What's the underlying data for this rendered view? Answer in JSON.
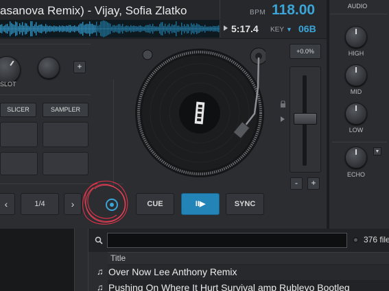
{
  "header": {
    "track_title": "asanova Remix) - Vijay, Sofia Zlatko",
    "bpm_label": "BPM",
    "bpm_value": "118.00",
    "time": "5:17.4",
    "key_label": "KEY",
    "key_caret": "▼",
    "key_value": "06B"
  },
  "audio_panel": {
    "title": "AUDIO",
    "high_label": "HIGH",
    "mid_label": "MID",
    "low_label": "LOW",
    "echo_label": "ECHO",
    "echo_dropdown": "▼"
  },
  "left_section": {
    "slot_label": "SLOT",
    "plus": "+",
    "slicer": "SLICER",
    "sampler": "SAMPLER"
  },
  "transport": {
    "prev": "‹",
    "loop_size": "1/4",
    "next": "›",
    "cue": "CUE",
    "play": "II▶",
    "sync": "SYNC"
  },
  "pitch": {
    "readout": "+0.0%",
    "minus": "-",
    "plus": "+"
  },
  "browser": {
    "search_value": "",
    "file_count": "376 file",
    "column_title": "Title",
    "rows": [
      {
        "icon": "♫",
        "title": "Over Now Lee Anthony Remix"
      },
      {
        "icon": "♫",
        "title": "Pushing On Where It Hurt Survival amp Rublevo Bootleg"
      }
    ]
  },
  "colors": {
    "accent": "#3ca5d8",
    "play_button": "#2384b8",
    "annotation": "#e8324a"
  }
}
